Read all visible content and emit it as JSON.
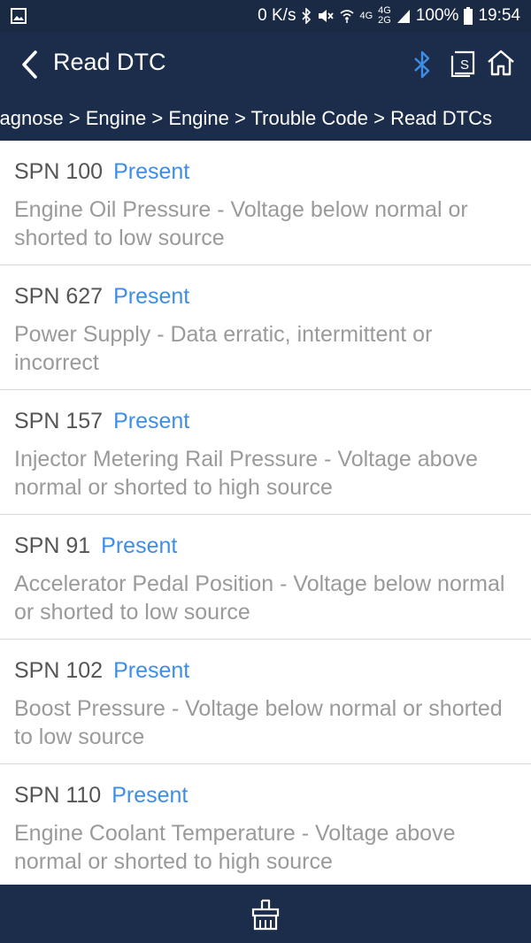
{
  "status_bar": {
    "network_speed": "0 K/s",
    "net_top": "4G",
    "net_sub": "4G",
    "net_sub2": "2G",
    "battery": "100%",
    "time": "19:54"
  },
  "header": {
    "title": "Read DTC",
    "breadcrumb": "Volvo > Diagnose > Engine > Engine > Trouble Code > Read DTCs"
  },
  "dtcs": [
    {
      "code": "SPN 100",
      "status": "Present",
      "description": "Engine Oil Pressure - Voltage below normal or shorted to low source"
    },
    {
      "code": "SPN 627",
      "status": "Present",
      "description": "Power Supply - Data erratic, intermittent or incorrect"
    },
    {
      "code": "SPN 157",
      "status": "Present",
      "description": "Injector Metering Rail Pressure - Voltage above normal or shorted to high source"
    },
    {
      "code": "SPN 91",
      "status": "Present",
      "description": "Accelerator Pedal Position - Voltage below normal or shorted to low source"
    },
    {
      "code": "SPN 102",
      "status": "Present",
      "description": "Boost Pressure - Voltage below normal or shorted to low source"
    },
    {
      "code": "SPN 110",
      "status": "Present",
      "description": "Engine Coolant Temperature - Voltage above normal or shorted to high source"
    }
  ],
  "icons": {
    "status_left": "image-icon",
    "back": "chevron-left-icon",
    "bluetooth": "bluetooth-icon",
    "screenshot": "screenshot-s-icon",
    "home": "home-icon",
    "bottom": "clear-broom-icon"
  },
  "colors": {
    "header_bg": "#1c2d4b",
    "status_bar_bg": "#1a2a44",
    "accent_blue": "#3d8ee6",
    "code_text": "#555555",
    "description_text": "#9a9a9a",
    "divider": "#d8d8d8"
  }
}
